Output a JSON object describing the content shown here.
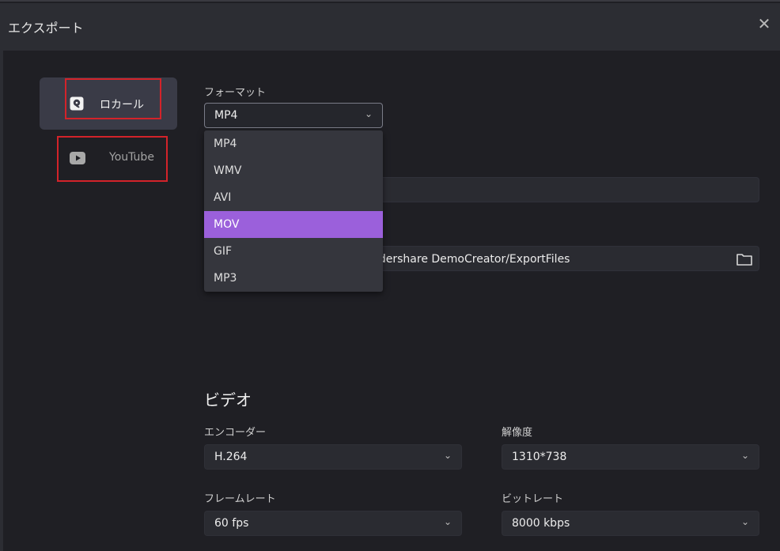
{
  "window": {
    "title": "エクスポート",
    "close_icon": "close-icon"
  },
  "sidebar": {
    "items": [
      {
        "label": "ロカール",
        "icon": "hard-drive-icon",
        "active": true
      },
      {
        "label": "YouTube",
        "icon": "youtube-play-icon",
        "active": false
      }
    ]
  },
  "format": {
    "label": "フォーマット",
    "selected": "MP4",
    "options": [
      "MP4",
      "WMV",
      "AVI",
      "MOV",
      "GIF",
      "MP3"
    ],
    "highlighted_option": "MOV"
  },
  "save_path": {
    "visible_text": "ndershare DemoCreator/ExportFiles",
    "folder_icon": "folder-icon"
  },
  "video": {
    "section_title": "ビデオ",
    "encoder": {
      "label": "エンコーダー",
      "value": "H.264"
    },
    "resolution": {
      "label": "解像度",
      "value": "1310*738"
    },
    "framerate": {
      "label": "フレームレート",
      "value": "60 fps"
    },
    "bitrate": {
      "label": "ビットレート",
      "value": "8000 kbps"
    }
  },
  "colors": {
    "accent": "#9b60db",
    "highlight_box": "#d3232a",
    "background": "#1f1f24"
  }
}
